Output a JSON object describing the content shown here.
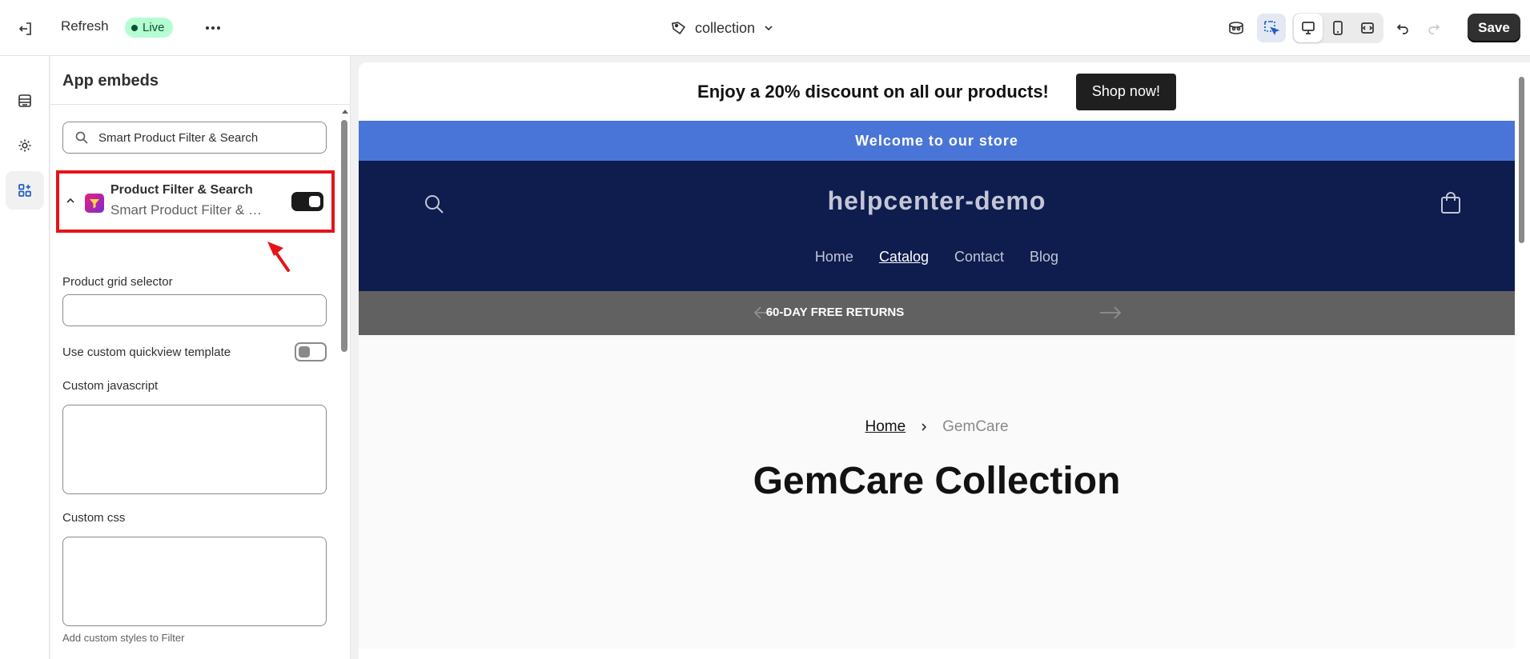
{
  "topbar": {
    "refresh_label": "Refresh",
    "live_badge": "Live",
    "template_name": "collection",
    "save_label": "Save"
  },
  "panel": {
    "title": "App embeds",
    "search": {
      "value": "Smart Product Filter & Search"
    },
    "embed": {
      "name": "Product Filter & Search",
      "subtitle": "Smart Product Filter & Search",
      "enabled": true
    },
    "fields": {
      "grid_selector_label": "Product grid selector",
      "quickview_label": "Use custom quickview template",
      "quickview_enabled": false,
      "custom_js_label": "Custom javascript",
      "custom_css_label": "Custom css",
      "custom_css_help": "Add custom styles to Filter"
    }
  },
  "preview": {
    "promo_text": "Enjoy a 20% discount on all our products!",
    "promo_button": "Shop now!",
    "welcome": "Welcome to our store",
    "store_name": "helpcenter-demo",
    "nav": [
      "Home",
      "Catalog",
      "Contact",
      "Blog"
    ],
    "returns": "60-DAY FREE RETURNS",
    "breadcrumb_home": "Home",
    "breadcrumb_current": "GemCare",
    "collection_title": "GemCare Collection"
  },
  "colors": {
    "accent_red": "#e3151a",
    "welcome_blue": "#4a75d8",
    "store_navy": "#0e1c4e",
    "live_green": "#b4fed2"
  }
}
